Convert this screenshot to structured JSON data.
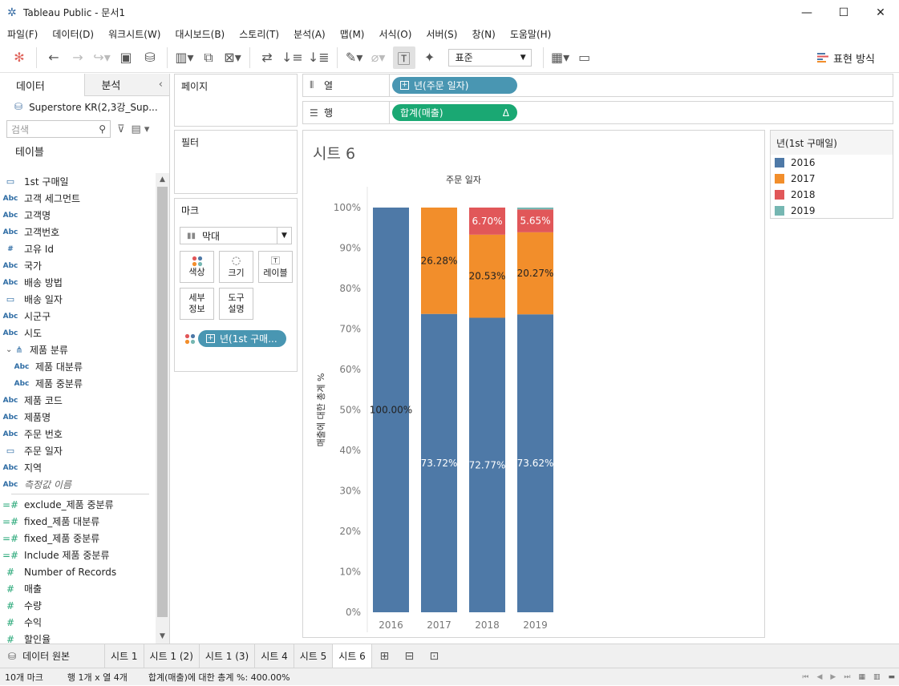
{
  "window": {
    "title": "Tableau Public - 문서1",
    "minimize": "—",
    "maximize": "☐",
    "close": "✕"
  },
  "menu": [
    "파일(F)",
    "데이터(D)",
    "워크시트(W)",
    "대시보드(B)",
    "스토리(T)",
    "분석(A)",
    "맵(M)",
    "서식(O)",
    "서버(S)",
    "창(N)",
    "도움말(H)"
  ],
  "toolbar": {
    "fit": "표준",
    "show_me": "표현 방식"
  },
  "data_pane": {
    "tab_data": "데이터",
    "tab_analysis": "분석",
    "datasource": "Superstore KR(2,3강_Sup...",
    "search_placeholder": "검색",
    "tables_header": "테이블",
    "fields": [
      {
        "type": "date",
        "name": "1st 구매일"
      },
      {
        "type": "abc",
        "name": "고객 세그먼트"
      },
      {
        "type": "abc",
        "name": "고객명"
      },
      {
        "type": "abc",
        "name": "고객번호"
      },
      {
        "type": "num",
        "name": "고유 Id"
      },
      {
        "type": "abc",
        "name": "국가"
      },
      {
        "type": "abc",
        "name": "배송 방법"
      },
      {
        "type": "date",
        "name": "배송 일자"
      },
      {
        "type": "abc",
        "name": "시군구"
      },
      {
        "type": "abc",
        "name": "시도"
      },
      {
        "type": "hier",
        "name": "제품 분류"
      },
      {
        "type": "abc",
        "name": "제품 대분류",
        "indent": true
      },
      {
        "type": "abc",
        "name": "제품 중분류",
        "indent": true
      },
      {
        "type": "abc",
        "name": "제품 코드"
      },
      {
        "type": "abc",
        "name": "제품명"
      },
      {
        "type": "abc",
        "name": "주문 번호"
      },
      {
        "type": "date",
        "name": "주문 일자"
      },
      {
        "type": "abc",
        "name": "지역"
      },
      {
        "type": "abc",
        "name": "측정값 이름",
        "italic": true
      },
      {
        "type": "sep"
      },
      {
        "type": "calc",
        "name": "exclude_제품 중분류"
      },
      {
        "type": "calc",
        "name": "fixed_제품 대분류"
      },
      {
        "type": "calc",
        "name": "fixed_제품 중분류"
      },
      {
        "type": "calc",
        "name": "Include 제품 중분류"
      },
      {
        "type": "meas",
        "name": "Number of Records"
      },
      {
        "type": "meas",
        "name": "매출"
      },
      {
        "type": "meas",
        "name": "수량"
      },
      {
        "type": "meas",
        "name": "수익"
      },
      {
        "type": "meas",
        "name": "할인율"
      }
    ]
  },
  "shelves": {
    "pages_label": "페이지",
    "filters_label": "필터",
    "columns_label": "열",
    "rows_label": "행",
    "columns_pill": "년(주문 일자)",
    "rows_pill": "합계(매출)",
    "rows_pill_delta": "Δ"
  },
  "marks": {
    "header": "마크",
    "mark_type": "막대",
    "color": "색상",
    "size": "크기",
    "label": "레이블",
    "detail_1": "세부",
    "detail_2": "정보",
    "tooltip_1": "도구",
    "tooltip_2": "설명",
    "color_pill": "년(1st 구매..."
  },
  "sheet": {
    "title": "시트 6"
  },
  "legend": {
    "title": "년(1st 구매일)",
    "items": [
      {
        "label": "2016",
        "color": "#4e79a7"
      },
      {
        "label": "2017",
        "color": "#f28e2b"
      },
      {
        "label": "2018",
        "color": "#e15759"
      },
      {
        "label": "2019",
        "color": "#76b7b2"
      }
    ]
  },
  "chart_data": {
    "type": "bar",
    "stacked": true,
    "title": "주문 일자",
    "ylabel": "매출에 대한 총계 %",
    "xlabel": "",
    "categories": [
      "2016",
      "2017",
      "2018",
      "2019"
    ],
    "yticks": [
      "0%",
      "10%",
      "20%",
      "30%",
      "40%",
      "50%",
      "60%",
      "70%",
      "80%",
      "90%",
      "100%"
    ],
    "ylim": [
      0,
      100
    ],
    "series": [
      {
        "name": "2016",
        "color": "#4e79a7",
        "values": [
          100.0,
          73.72,
          72.77,
          73.62
        ],
        "labels": [
          "100.00%",
          "73.72%",
          "72.77%",
          "73.62%"
        ]
      },
      {
        "name": "2017",
        "color": "#f28e2b",
        "values": [
          0,
          26.28,
          20.53,
          20.27
        ],
        "labels": [
          "",
          "26.28%",
          "20.53%",
          "20.27%"
        ]
      },
      {
        "name": "2018",
        "color": "#e15759",
        "values": [
          0,
          0,
          6.7,
          5.65
        ],
        "labels": [
          "",
          "",
          "6.70%",
          "5.65%"
        ]
      },
      {
        "name": "2019",
        "color": "#76b7b2",
        "values": [
          0,
          0,
          0,
          0.46
        ],
        "labels": [
          "",
          "",
          "",
          ""
        ]
      }
    ]
  },
  "tabs": {
    "datasource": "데이터 원본",
    "sheets": [
      "시트 1",
      "시트 1 (2)",
      "시트 1 (3)",
      "시트 4",
      "시트 5",
      "시트 6"
    ],
    "active": "시트 6"
  },
  "status": {
    "marks": "10개 마크",
    "dims": "행 1개 x 열 4개",
    "sum": "합계(매출)에 대한 총계 %: 400.00%"
  }
}
